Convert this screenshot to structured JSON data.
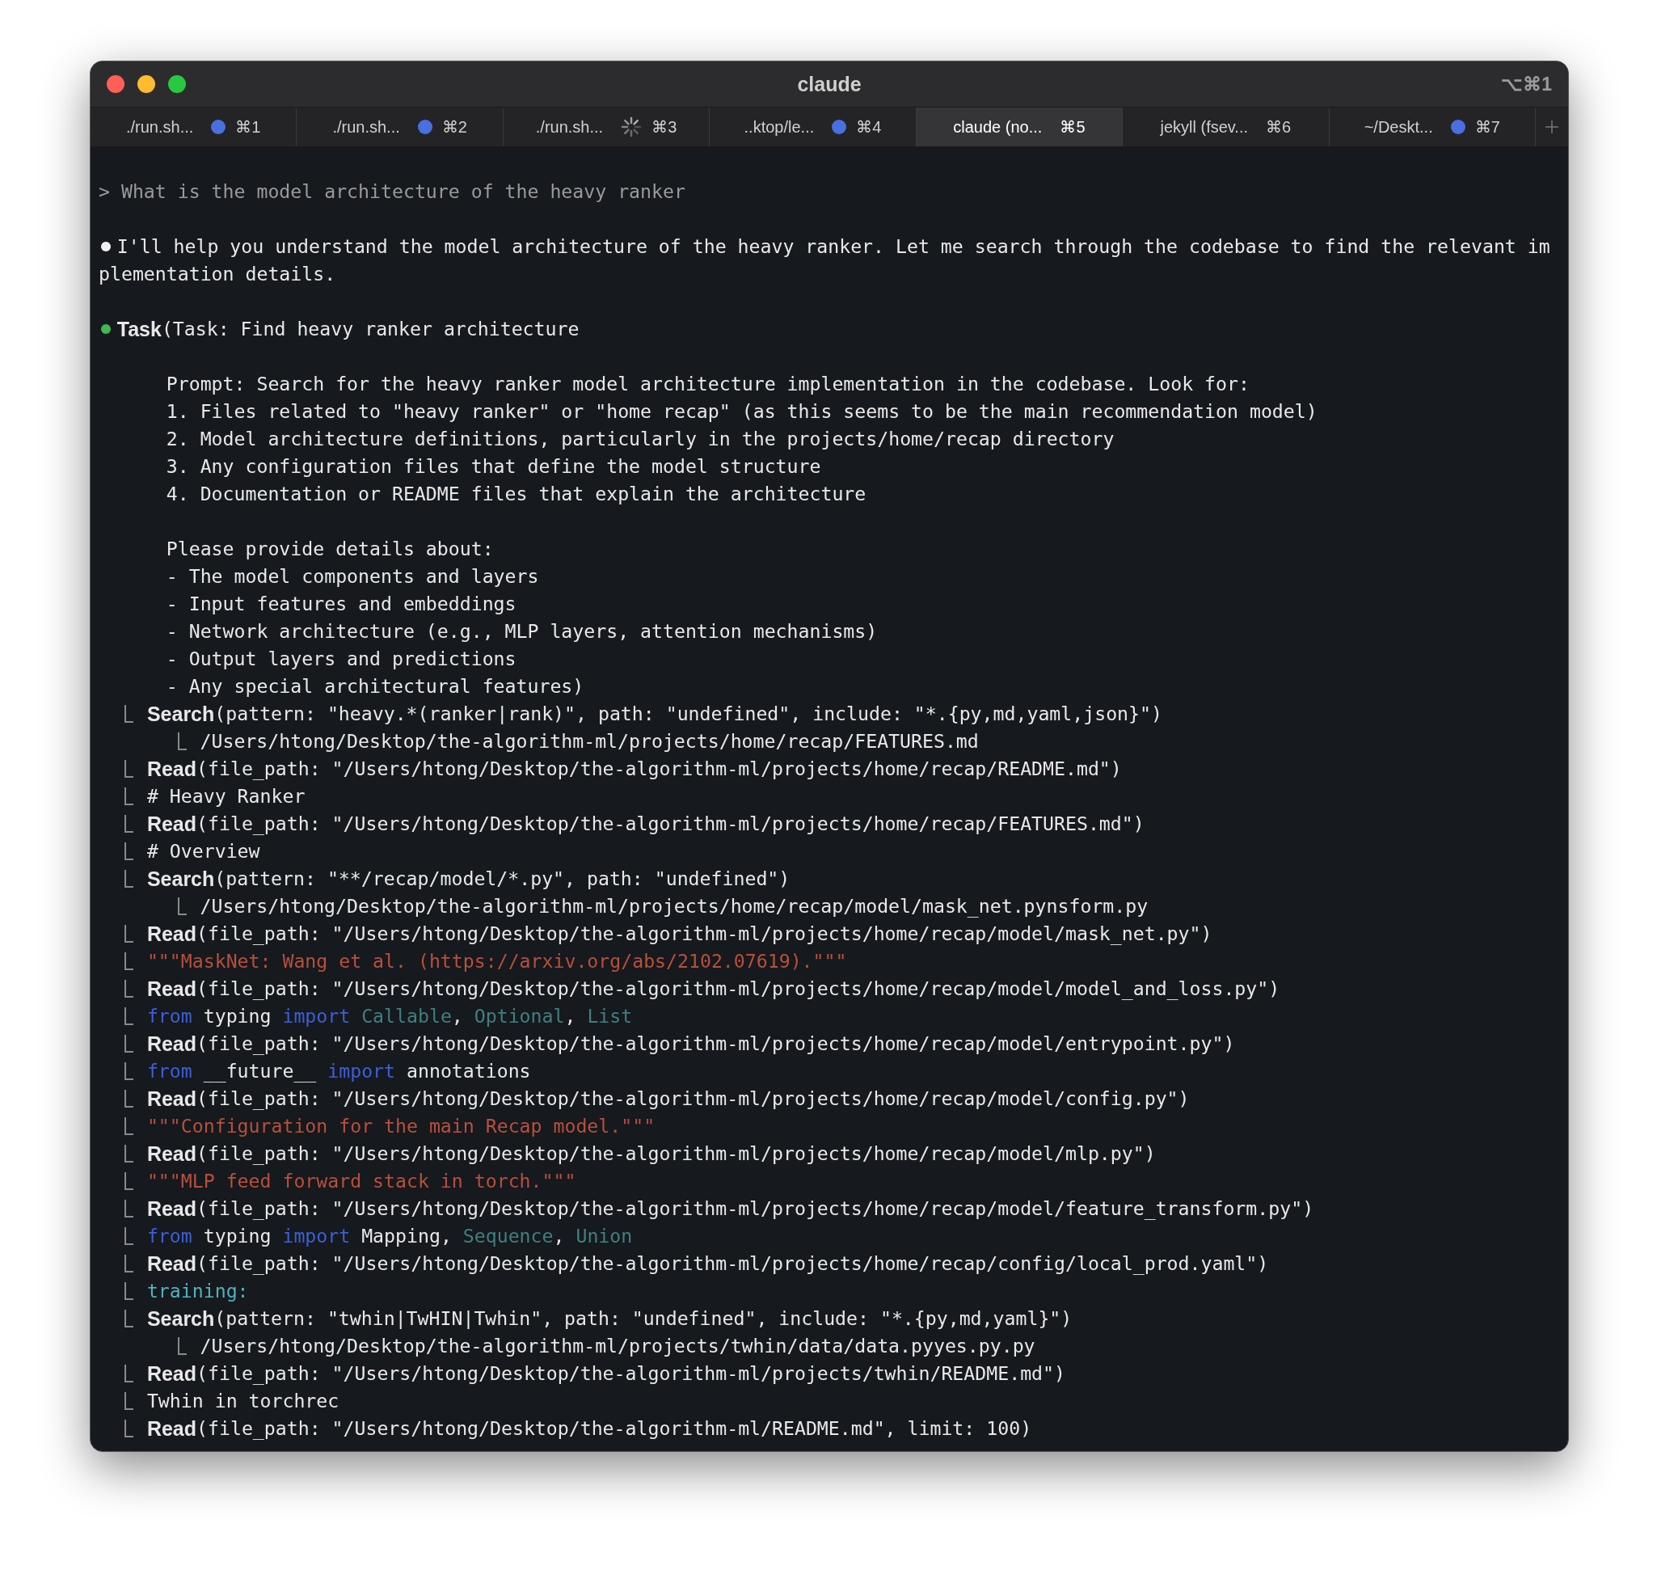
{
  "window": {
    "title": "claude",
    "shortcut": "⌥⌘1"
  },
  "tabs": [
    {
      "label": "./run.sh...",
      "kind": "dot",
      "shortcut": "⌘1",
      "selected": false
    },
    {
      "label": "./run.sh...",
      "kind": "dot",
      "shortcut": "⌘2",
      "selected": false
    },
    {
      "label": "./run.sh...",
      "kind": "spinner",
      "shortcut": "⌘3",
      "selected": false
    },
    {
      "label": "..ktop/le...",
      "kind": "dot",
      "shortcut": "⌘4",
      "selected": false
    },
    {
      "label": "claude (no...",
      "kind": "plain",
      "shortcut": "⌘5",
      "selected": true
    },
    {
      "label": "jekyll (fsev...",
      "kind": "plain",
      "shortcut": "⌘6",
      "selected": false
    },
    {
      "label": "~/Deskt...",
      "kind": "dot",
      "shortcut": "⌘7",
      "selected": false
    }
  ],
  "prompt": "> What is the model architecture of the heavy ranker",
  "message": [
    "I'll help you understand the model architecture of the heavy ranker. Let me search through the codebase to find the relevant im",
    "plementation details."
  ],
  "task": {
    "tool": "Task",
    "args": "(Task: Find heavy ranker architecture",
    "paragraphs": [
      [
        "Prompt: Search for the heavy ranker model architecture implementation in the codebase. Look for:",
        "1. Files related to \"heavy ranker\" or \"home recap\" (as this seems to be the main recommendation model)",
        "2. Model architecture definitions, particularly in the projects/home/recap directory",
        "3. Any configuration files that define the model structure",
        "4. Documentation or README files that explain the architecture"
      ],
      [
        "Please provide details about:",
        "- The model components and layers",
        "- Input features and embeddings",
        "- Network architecture (e.g., MLP layers, attention mechanisms)",
        "- Output layers and predictions",
        "- Any special architectural features)"
      ]
    ]
  },
  "steps": [
    {
      "kind": "call",
      "tool": "Search",
      "args": "(pattern: \"heavy.*(ranker|rank)\", path: \"undefined\", include: \"*.{py,md,yaml,json}\")",
      "children": [
        {
          "kind": "output",
          "segments": [
            {
              "kind": "text",
              "text": "/Users/htong/Desktop/the-algorithm-ml/projects/home/recap/FEATURES.md"
            }
          ]
        }
      ]
    },
    {
      "kind": "call",
      "tool": "Read",
      "args": "(file_path: \"/Users/htong/Desktop/the-algorithm-ml/projects/home/recap/README.md\")"
    },
    {
      "kind": "output",
      "segments": [
        {
          "kind": "text",
          "text": "# Heavy Ranker"
        }
      ]
    },
    {
      "kind": "call",
      "tool": "Read",
      "args": "(file_path: \"/Users/htong/Desktop/the-algorithm-ml/projects/home/recap/FEATURES.md\")"
    },
    {
      "kind": "output",
      "segments": [
        {
          "kind": "text",
          "text": "# Overview"
        }
      ]
    },
    {
      "kind": "call",
      "tool": "Search",
      "args": "(pattern: \"**/recap/model/*.py\", path: \"undefined\")",
      "children": [
        {
          "kind": "output",
          "segments": [
            {
              "kind": "text",
              "text": "/Users/htong/Desktop/the-algorithm-ml/projects/home/recap/model/mask_net.pynsform.py"
            }
          ]
        }
      ]
    },
    {
      "kind": "call",
      "tool": "Read",
      "args": "(file_path: \"/Users/htong/Desktop/the-algorithm-ml/projects/home/recap/model/mask_net.py\")"
    },
    {
      "kind": "output",
      "segments": [
        {
          "kind": "string",
          "text": "\"\"\"MaskNet: Wang et al. (https://arxiv.org/abs/2102.07619).\"\"\""
        }
      ]
    },
    {
      "kind": "call",
      "tool": "Read",
      "args": "(file_path: \"/Users/htong/Desktop/the-algorithm-ml/projects/home/recap/model/model_and_loss.py\")"
    },
    {
      "kind": "output",
      "segments": [
        {
          "kind": "keyword",
          "text": "from"
        },
        {
          "kind": "text",
          "text": " typing "
        },
        {
          "kind": "keyword",
          "text": "import"
        },
        {
          "kind": "identifier",
          "text": " Callable"
        },
        {
          "kind": "text",
          "text": ", "
        },
        {
          "kind": "identifier",
          "text": "Optional"
        },
        {
          "kind": "text",
          "text": ", "
        },
        {
          "kind": "identifier",
          "text": "List"
        }
      ]
    },
    {
      "kind": "call",
      "tool": "Read",
      "args": "(file_path: \"/Users/htong/Desktop/the-algorithm-ml/projects/home/recap/model/entrypoint.py\")"
    },
    {
      "kind": "output",
      "segments": [
        {
          "kind": "keyword",
          "text": "from"
        },
        {
          "kind": "text",
          "text": " __future__ "
        },
        {
          "kind": "keyword",
          "text": "import"
        },
        {
          "kind": "text",
          "text": " annotations"
        }
      ]
    },
    {
      "kind": "call",
      "tool": "Read",
      "args": "(file_path: \"/Users/htong/Desktop/the-algorithm-ml/projects/home/recap/model/config.py\")"
    },
    {
      "kind": "output",
      "segments": [
        {
          "kind": "string",
          "text": "\"\"\"Configuration for the main Recap model.\"\"\""
        }
      ]
    },
    {
      "kind": "call",
      "tool": "Read",
      "args": "(file_path: \"/Users/htong/Desktop/the-algorithm-ml/projects/home/recap/model/mlp.py\")"
    },
    {
      "kind": "output",
      "segments": [
        {
          "kind": "string",
          "text": "\"\"\"MLP feed forward stack in torch.\"\"\""
        }
      ]
    },
    {
      "kind": "call",
      "tool": "Read",
      "args": "(file_path: \"/Users/htong/Desktop/the-algorithm-ml/projects/home/recap/model/feature_transform.py\")"
    },
    {
      "kind": "output",
      "segments": [
        {
          "kind": "keyword",
          "text": "from"
        },
        {
          "kind": "text",
          "text": " typing "
        },
        {
          "kind": "keyword",
          "text": "import"
        },
        {
          "kind": "text",
          "text": " Mapping, "
        },
        {
          "kind": "identifier",
          "text": "Sequence"
        },
        {
          "kind": "text",
          "text": ", "
        },
        {
          "kind": "identifier",
          "text": "Union"
        }
      ]
    },
    {
      "kind": "call",
      "tool": "Read",
      "args": "(file_path: \"/Users/htong/Desktop/the-algorithm-ml/projects/home/recap/config/local_prod.yaml\")"
    },
    {
      "kind": "output",
      "segments": [
        {
          "kind": "yaml_key",
          "text": "training:"
        }
      ]
    },
    {
      "kind": "call",
      "tool": "Search",
      "args": "(pattern: \"twhin|TwHIN|Twhin\", path: \"undefined\", include: \"*.{py,md,yaml}\")",
      "children": [
        {
          "kind": "output",
          "segments": [
            {
              "kind": "text",
              "text": "/Users/htong/Desktop/the-algorithm-ml/projects/twhin/data/data.pyyes.py.py"
            }
          ]
        }
      ]
    },
    {
      "kind": "call",
      "tool": "Read",
      "args": "(file_path: \"/Users/htong/Desktop/the-algorithm-ml/projects/twhin/README.md\")"
    },
    {
      "kind": "output",
      "segments": [
        {
          "kind": "text",
          "text": "Twhin in torchrec"
        }
      ]
    },
    {
      "kind": "call",
      "tool": "Read",
      "args": "(file_path: \"/Users/htong/Desktop/the-algorithm-ml/README.md\", limit: 100)"
    }
  ]
}
